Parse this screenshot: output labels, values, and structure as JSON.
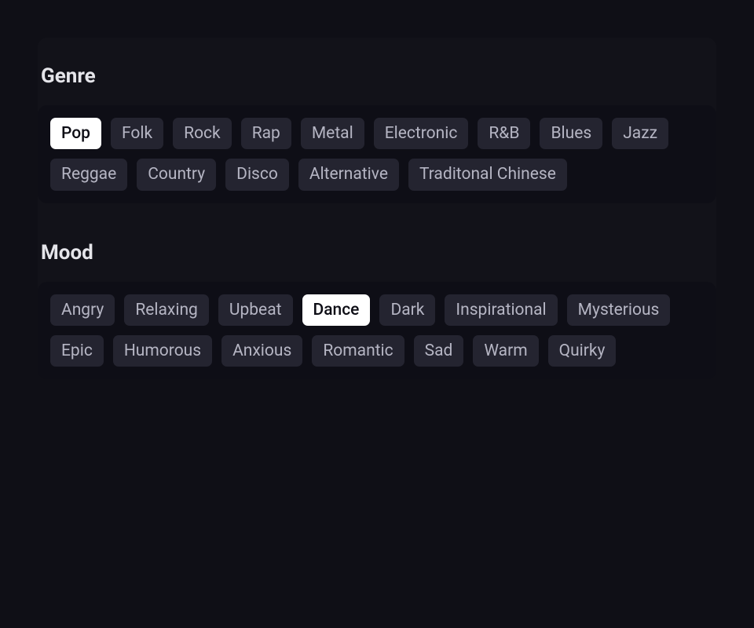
{
  "sections": [
    {
      "key": "genre",
      "title": "Genre",
      "tags": [
        {
          "label": "Pop",
          "selected": true
        },
        {
          "label": "Folk",
          "selected": false
        },
        {
          "label": "Rock",
          "selected": false
        },
        {
          "label": "Rap",
          "selected": false
        },
        {
          "label": "Metal",
          "selected": false
        },
        {
          "label": "Electronic",
          "selected": false
        },
        {
          "label": "R&B",
          "selected": false
        },
        {
          "label": "Blues",
          "selected": false
        },
        {
          "label": "Jazz",
          "selected": false
        },
        {
          "label": "Reggae",
          "selected": false
        },
        {
          "label": "Country",
          "selected": false
        },
        {
          "label": "Disco",
          "selected": false
        },
        {
          "label": "Alternative",
          "selected": false
        },
        {
          "label": "Traditonal Chinese",
          "selected": false
        }
      ]
    },
    {
      "key": "mood",
      "title": "Mood",
      "tags": [
        {
          "label": "Angry",
          "selected": false
        },
        {
          "label": "Relaxing",
          "selected": false
        },
        {
          "label": "Upbeat",
          "selected": false
        },
        {
          "label": "Dance",
          "selected": true
        },
        {
          "label": "Dark",
          "selected": false
        },
        {
          "label": "Inspirational",
          "selected": false
        },
        {
          "label": "Mysterious",
          "selected": false
        },
        {
          "label": "Epic",
          "selected": false
        },
        {
          "label": "Humorous",
          "selected": false
        },
        {
          "label": "Anxious",
          "selected": false
        },
        {
          "label": "Romantic",
          "selected": false
        },
        {
          "label": "Sad",
          "selected": false
        },
        {
          "label": "Warm",
          "selected": false
        },
        {
          "label": "Quirky",
          "selected": false
        }
      ]
    }
  ]
}
